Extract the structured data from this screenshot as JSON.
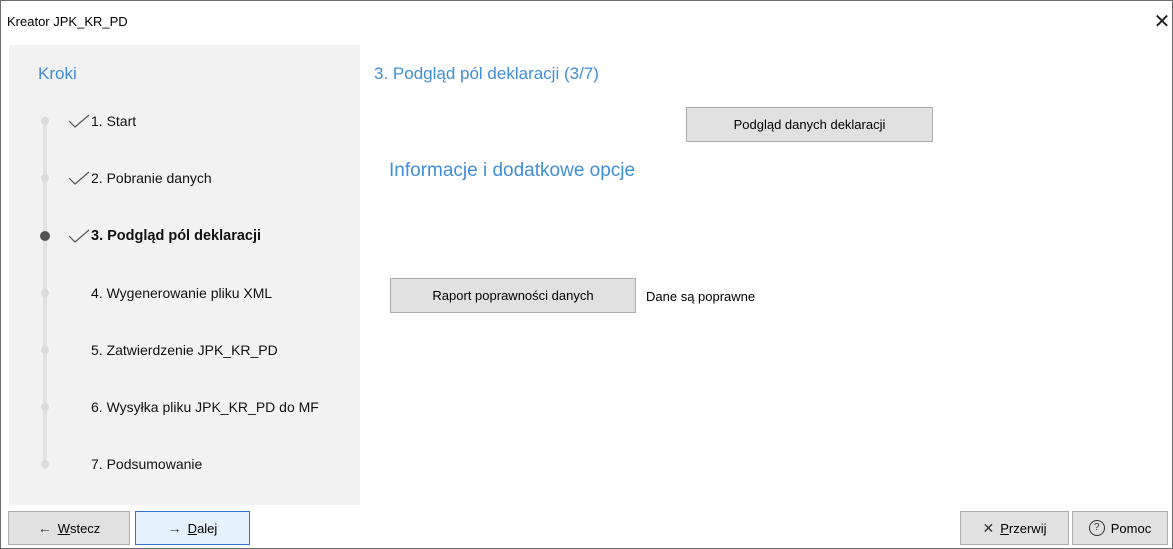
{
  "window": {
    "title": "Kreator JPK_KR_PD",
    "close_glyph": "✕"
  },
  "steps": {
    "heading": "Kroki",
    "items": [
      {
        "label": "1. Start",
        "done": true,
        "current": false
      },
      {
        "label": "2. Pobranie danych",
        "done": true,
        "current": false
      },
      {
        "label": "3. Podgląd pól deklaracji",
        "done": true,
        "current": true
      },
      {
        "label": "4. Wygenerowanie pliku XML",
        "done": false,
        "current": false
      },
      {
        "label": "5. Zatwierdzenie JPK_KR_PD",
        "done": false,
        "current": false
      },
      {
        "label": "6. Wysyłka pliku JPK_KR_PD do MF",
        "done": false,
        "current": false
      },
      {
        "label": "7. Podsumowanie",
        "done": false,
        "current": false
      }
    ]
  },
  "main": {
    "title": "3. Podgląd pól deklaracji (3/7)",
    "preview_button": "Podgląd danych deklaracji",
    "info_heading": "Informacje i dodatkowe opcje",
    "report_button": "Raport poprawności danych",
    "status_text": "Dane są poprawne"
  },
  "footer": {
    "back": {
      "icon": "←",
      "first": "W",
      "rest": "stecz"
    },
    "next": {
      "icon": "→",
      "first": "D",
      "rest": "alej"
    },
    "abort": {
      "icon": "✕",
      "first": "P",
      "rest": "rzerwij"
    },
    "help": {
      "icon": "?",
      "label": "Pomoc"
    }
  },
  "colors": {
    "accent": "#3f8ed9",
    "panel": "#f2f2f2",
    "button": "#e1e1e1",
    "focus": "#2f74c9"
  }
}
